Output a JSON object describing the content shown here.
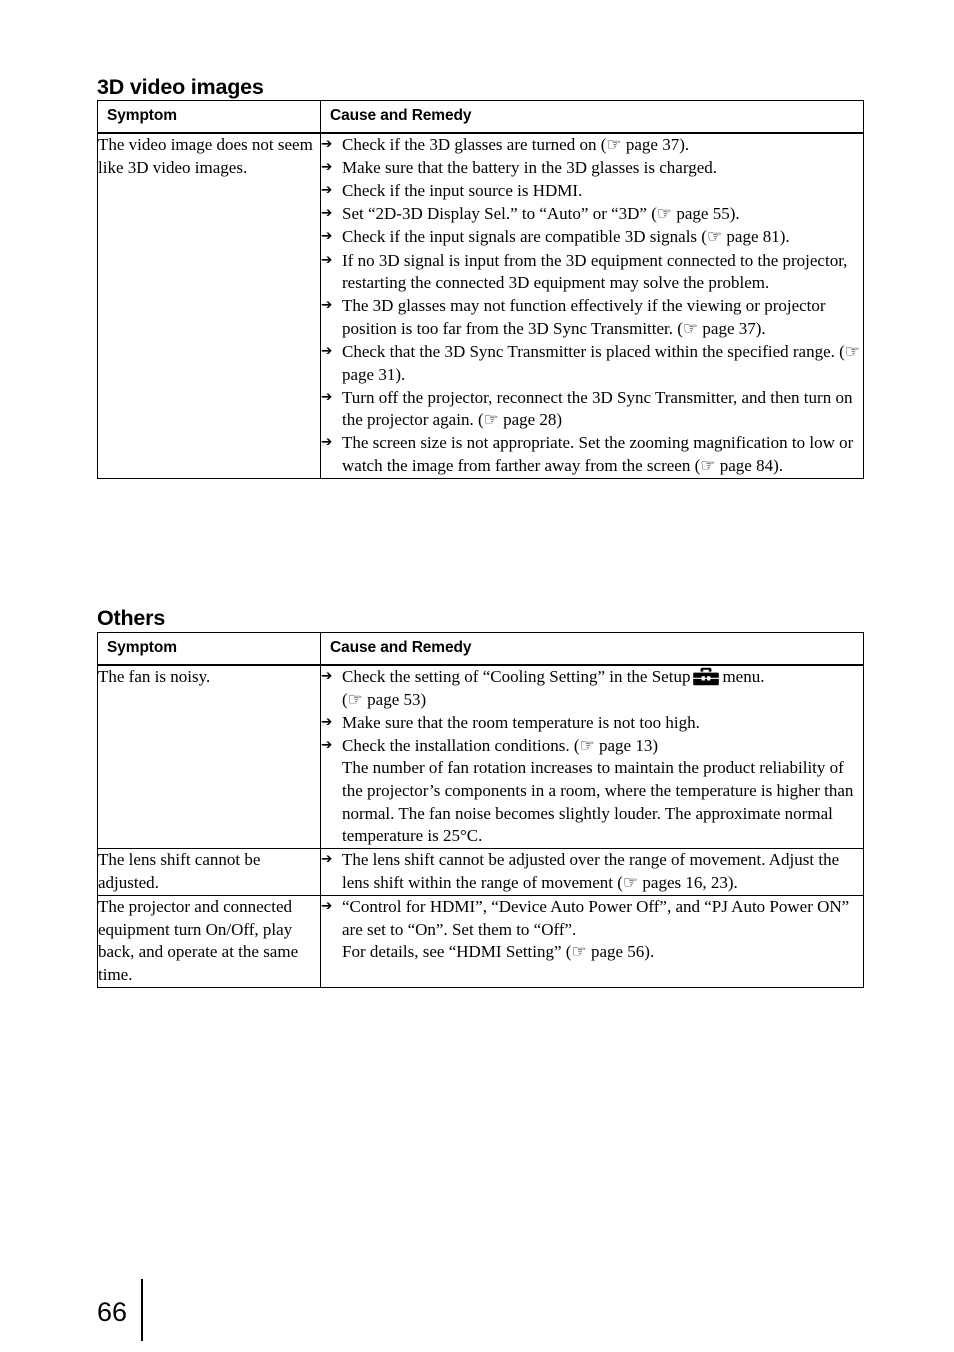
{
  "page": {
    "number": "66"
  },
  "icons": {
    "arrow": "arrow-bullet",
    "hand": "pointing-hand-icon",
    "setup_menu": "toolbox-icon"
  },
  "sections": [
    {
      "heading": "3D video images",
      "table": {
        "columns": [
          "Symptom",
          "Cause and Remedy"
        ],
        "rows": [
          {
            "symptom": "The video image does not seem like 3D video images.",
            "remedies": [
              "Check if the 3D glasses are turned on (☞ page 37).",
              "Make sure that the battery in the 3D glasses is charged.",
              "Check if the input source is HDMI.",
              "Set “2D-3D Display Sel.” to “Auto” or “3D” (☞ page 55).",
              "Check if the input signals are compatible 3D signals (☞ page 81).",
              "If no 3D signal is input from the 3D equipment connected to the projector, restarting the connected 3D equipment may solve the problem.",
              "The 3D glasses may not function effectively if the viewing or projector position is too far from the 3D Sync Transmitter. (☞ page 37).",
              "Check that the 3D Sync Transmitter is placed within the specified range. (☞ page 31).",
              "Turn off the projector, reconnect the 3D Sync Transmitter, and then turn on the projector again. (☞ page 28)",
              "The screen size is not appropriate. Set the zooming magnification to low or watch the image from farther away from the screen (☞ page 84)."
            ]
          }
        ]
      }
    },
    {
      "heading": "Others",
      "table": {
        "columns": [
          "Symptom",
          "Cause and Remedy"
        ],
        "rows": [
          {
            "symptom": "The fan is noisy.",
            "remedy_parts": {
              "fan_line_pre": "Check the setting of “Cooling Setting” in the Setup",
              "fan_line_post": "menu.",
              "fan_line_page": "(☞ page 53)"
            },
            "remedies": [
              "Make sure that the room temperature is not too high.",
              "Check the installation conditions. (☞ page 13)"
            ],
            "continuation": "The number of fan rotation increases to maintain the product reliability of the projector’s components in a room, where the temperature is higher than normal. The fan noise becomes slightly louder. The approximate normal temperature is 25°C."
          },
          {
            "symptom": "The lens shift cannot be adjusted.",
            "remedies": [
              "The lens shift cannot be adjusted over the range of movement. Adjust the lens shift within the range of movement (☞ pages 16, 23)."
            ]
          },
          {
            "symptom": "The projector and connected equipment turn On/Off, play back, and operate at the same time.",
            "remedies": [
              "“Control for HDMI”, “Device Auto Power Off”, and “PJ Auto Power ON” are set to “On”. Set them to “Off”."
            ],
            "continuation": "For details, see “HDMI Setting” (☞ page 56)."
          }
        ]
      }
    }
  ]
}
